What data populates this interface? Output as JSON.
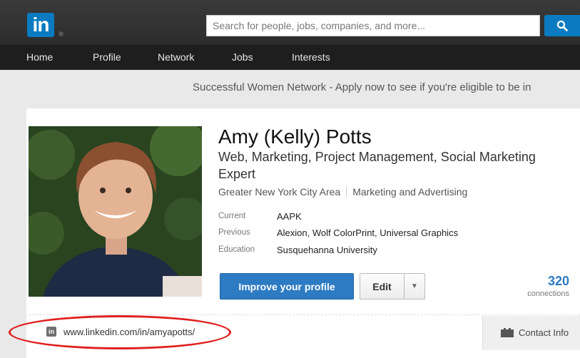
{
  "header": {
    "logo_text": "in",
    "search_placeholder": "Search for people, jobs, companies, and more..."
  },
  "nav": {
    "items": [
      "Home",
      "Profile",
      "Network",
      "Jobs",
      "Interests"
    ]
  },
  "promo": {
    "text": "Successful Women Network - Apply now to see if you're eligible to be in"
  },
  "profile": {
    "name": "Amy (Kelly) Potts",
    "headline": "Web, Marketing, Project Management, Social Marketing Expert",
    "location": "Greater New York City Area",
    "industry": "Marketing and Advertising",
    "facts": [
      {
        "label": "Current",
        "value": "AAPK"
      },
      {
        "label": "Previous",
        "value": "Alexion, Wolf ColorPrint, Universal Graphics"
      },
      {
        "label": "Education",
        "value": "Susquehanna University"
      }
    ],
    "improve_label": "Improve your profile",
    "edit_label": "Edit",
    "connections_count": "320",
    "connections_label": "connections",
    "public_url": "www.linkedin.com/in/amyapotts/",
    "contact_info_label": "Contact Info"
  },
  "colors": {
    "brand_blue": "#0a7bc0",
    "button_blue": "#2d7bc2",
    "highlight_red": "#e02020"
  },
  "icons": [
    "search-icon",
    "linkedin-icon",
    "contact-card-icon",
    "chevron-down-icon"
  ]
}
